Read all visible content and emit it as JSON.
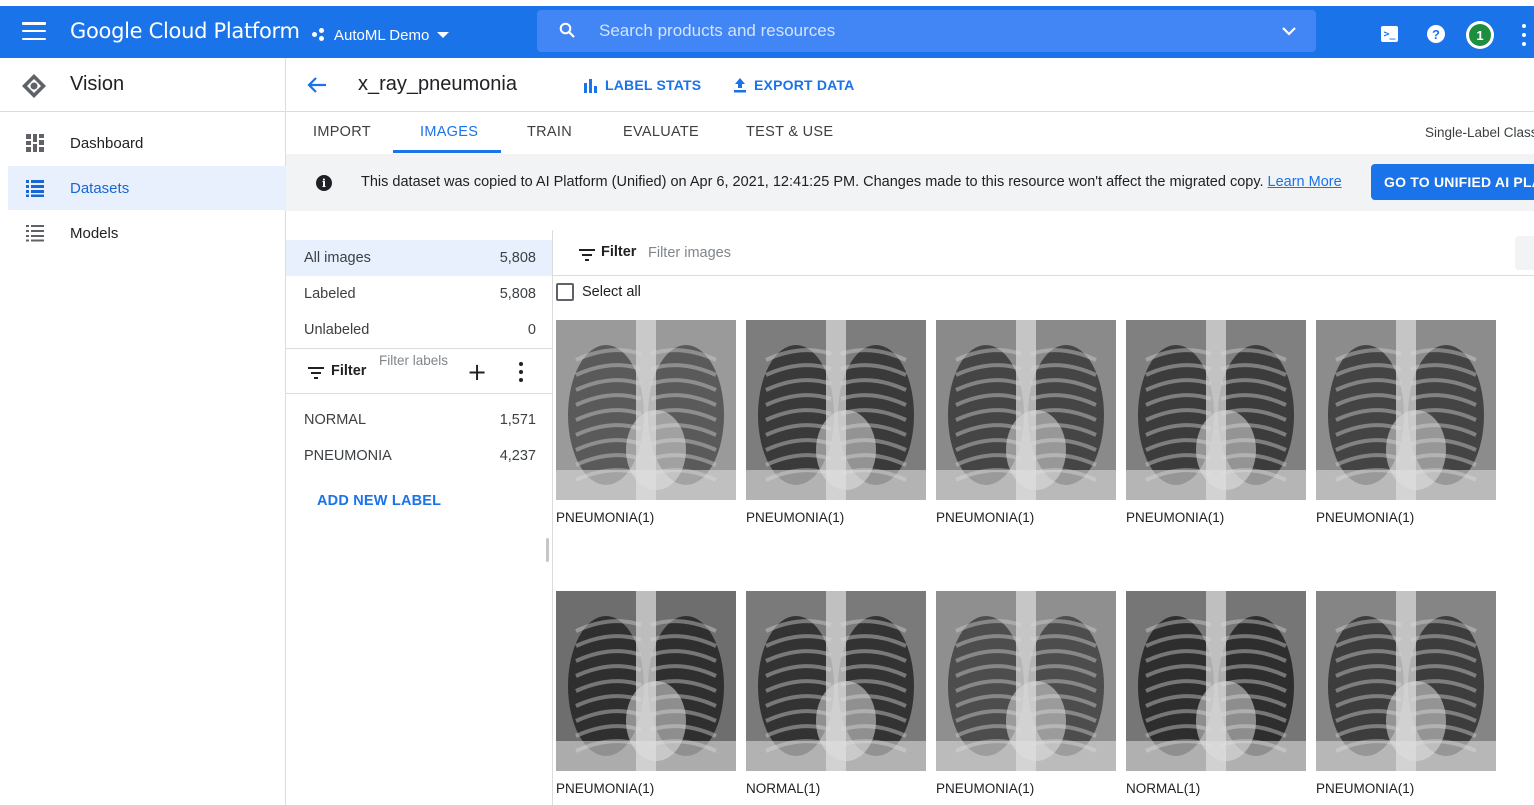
{
  "app": {
    "brand": "Google Cloud Platform",
    "project": "AutoML Demo",
    "search_placeholder": "Search products and resources",
    "terminal_glyph": ">_",
    "help_glyph": "?",
    "notification_count": "1",
    "accent_color": "#1a73e8"
  },
  "nav": {
    "title": "Vision",
    "items": [
      {
        "label": "Dashboard",
        "icon": "dashboard-icon"
      },
      {
        "label": "Datasets",
        "icon": "list-icon",
        "active": true
      },
      {
        "label": "Models",
        "icon": "list-icon"
      }
    ]
  },
  "dataset": {
    "name": "x_ray_pneumonia",
    "label_stats": "LABEL STATS",
    "export_data": "EXPORT DATA"
  },
  "tabs": [
    {
      "label": "IMPORT"
    },
    {
      "label": "IMAGES",
      "active": true
    },
    {
      "label": "TRAIN"
    },
    {
      "label": "EVALUATE"
    },
    {
      "label": "TEST & USE"
    }
  ],
  "classification_type": "Single-Label Class",
  "banner": {
    "message": "This dataset was copied to AI Platform (Unified) on Apr 6, 2021, 12:41:25 PM. Changes made to this resource won't affect the migrated copy.",
    "learn_more": "Learn More",
    "button": "GO TO UNIFIED AI PLA"
  },
  "label_panel": {
    "summary": [
      {
        "name": "All images",
        "count": "5,808",
        "selected": true
      },
      {
        "name": "Labeled",
        "count": "5,808"
      },
      {
        "name": "Unlabeled",
        "count": "0"
      }
    ],
    "filter_label": "Filter",
    "filter_placeholder": "Filter labels",
    "add_glyph": "+",
    "labels": [
      {
        "name": "NORMAL",
        "count": "1,571"
      },
      {
        "name": "PNEUMONIA",
        "count": "4,237"
      }
    ],
    "add_new_label": "ADD NEW LABEL"
  },
  "image_grid": {
    "filter_label": "Filter",
    "filter_placeholder": "Filter images",
    "select_all": "Select all",
    "images": [
      {
        "caption": "PNEUMONIA(1)"
      },
      {
        "caption": "PNEUMONIA(1)"
      },
      {
        "caption": "PNEUMONIA(1)"
      },
      {
        "caption": "PNEUMONIA(1)"
      },
      {
        "caption": "PNEUMONIA(1)"
      },
      {
        "caption": "PNEUMONIA(1)"
      },
      {
        "caption": "NORMAL(1)"
      },
      {
        "caption": "PNEUMONIA(1)"
      },
      {
        "caption": "NORMAL(1)"
      },
      {
        "caption": "PNEUMONIA(1)"
      }
    ]
  }
}
